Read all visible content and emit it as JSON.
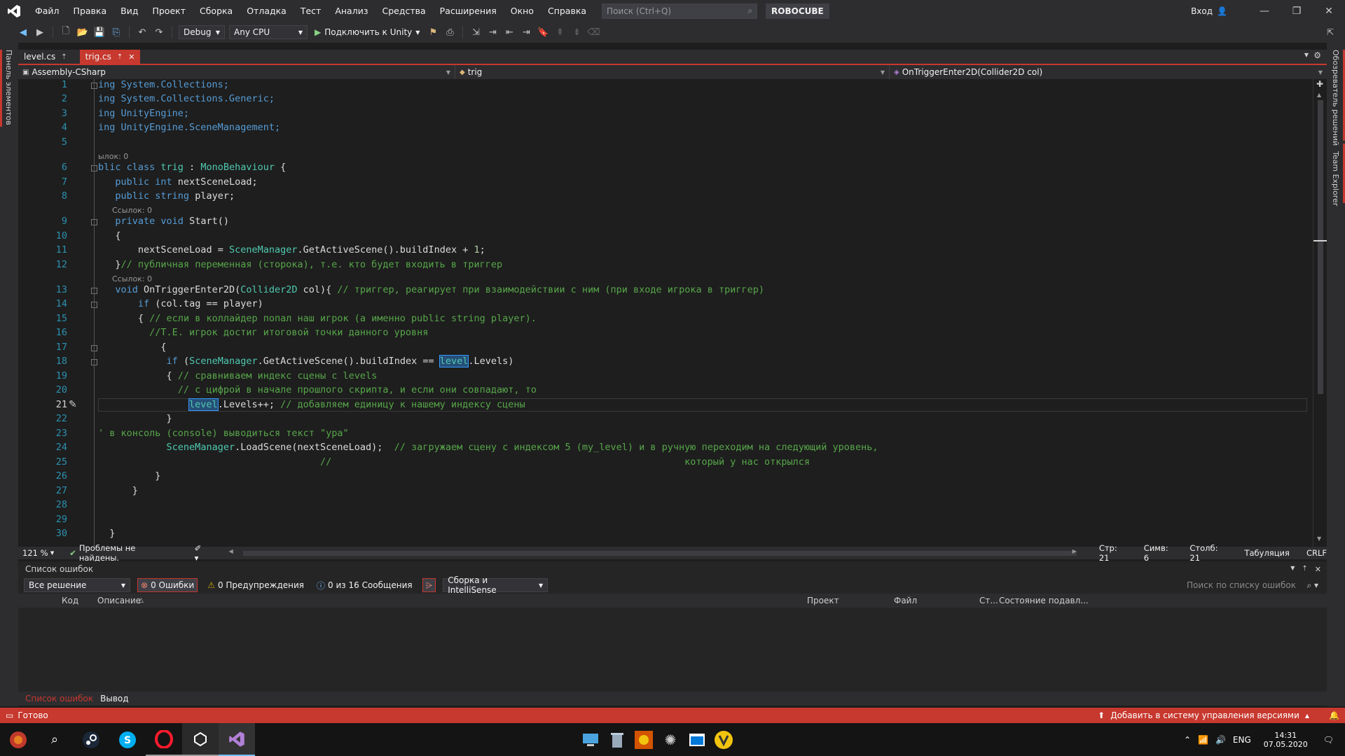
{
  "menubar": {
    "items": [
      "Файл",
      "Правка",
      "Вид",
      "Проект",
      "Сборка",
      "Отладка",
      "Тест",
      "Анализ",
      "Средства",
      "Расширения",
      "Окно",
      "Справка"
    ],
    "search_placeholder": "Поиск (Ctrl+Q)",
    "solution_name": "ROBOCUBE",
    "signin": "Вход"
  },
  "toolbar": {
    "config": "Debug",
    "platform": "Any CPU",
    "attach": "Подключить к Unity"
  },
  "side": {
    "left_tab": "Панель элементов",
    "right_tab_1": "Обозреватель решений",
    "right_tab_2": "Team Explorer"
  },
  "tabs": [
    {
      "name": "level.cs",
      "pin": "⇡"
    },
    {
      "name": "trig.cs",
      "pin": "⇡",
      "close": "✕"
    }
  ],
  "navbar": {
    "project": "Assembly-CSharp",
    "class": "trig",
    "member": "OnTriggerEnter2D(Collider2D col)"
  },
  "editor": {
    "line_numbers": [
      "1",
      "2",
      "3",
      "4",
      "5",
      "6",
      "7",
      "8",
      "9",
      "10",
      "11",
      "12",
      "13",
      "14",
      "15",
      "16",
      "17",
      "18",
      "19",
      "20",
      "21",
      "22",
      "23",
      "24",
      "25",
      "26",
      "27",
      "28",
      "29",
      "30"
    ],
    "codelens_1": "ылок: 0",
    "codelens_2": "Ссылок: 0",
    "codelens_3": "Ссылок: 0",
    "l1": "ing System.Collections;",
    "l2": "ing System.Collections.Generic;",
    "l3": "ing UnityEngine;",
    "l4": "ing UnityEngine.SceneManagement;",
    "l6a": "blic class ",
    "l6b": "trig",
    "l6c": " : ",
    "l6d": "MonoBehaviour",
    "l6e": " {",
    "l7a": "public int",
    "l7b": " nextSceneLoad;",
    "l8a": "public string",
    "l8b": " player;",
    "l9a": "private void",
    "l9b": " Start()",
    "l10": "{",
    "l11a": "nextSceneLoad = ",
    "l11b": "SceneManager",
    "l11c": ".GetActiveScene().buildIndex + ",
    "l11d": "1",
    "l11e": ";",
    "l12a": "}",
    "l12b": "// публичная переменная (сторока), т.е. кто будет входить в триггер",
    "l13a": "void",
    "l13b": " OnTriggerEnter2D(",
    "l13c": "Collider2D",
    "l13d": " col){ ",
    "l13e": "// триггер, реагирует при взаимодействии с ним (при входе игрока в триггер)",
    "l14a": "if",
    "l14b": " (col.tag == player)",
    "l15a": "{ ",
    "l15b": "// если в коллайдер попал наш игрок (а именно public string player).",
    "l16": "//Т.Е. игрок достиг итоговой точки данного уровня",
    "l17": "{",
    "l18a": "if",
    "l18b": " (",
    "l18c": "SceneManager",
    "l18d": ".GetActiveScene().buildIndex == ",
    "l18e": "level",
    "l18f": ".Levels)",
    "l19a": "{ ",
    "l19b": "// сравниваем индекс сцены с levels",
    "l20": "// с цифрой в начале прошлого скрипта, и если они совпадают, то",
    "l21a": "level",
    "l21b": ".Levels++; ",
    "l21c": "// добавляем единицу к нашему индексу сцены",
    "l22": "}",
    "l23": "' в консоль (console) выводиться текст \"ура\"",
    "l24a": "SceneManager",
    "l24b": ".LoadScene(nextSceneLoad);  ",
    "l24c": "// загружаем сцену с индексом 5 (my_level) и в ручную переходим на следующий уровень,",
    "l25a": "//",
    "l25b": "который у нас открылся",
    "l26": "}",
    "l27": "}",
    "l30": "}"
  },
  "editor_status": {
    "zoom": "121 %",
    "issues": "Проблемы не найдены.",
    "line": "Стр: 21",
    "char": "Симв: 6",
    "col": "Столб: 21",
    "tabs": "Табуляция",
    "eol": "CRLF"
  },
  "error_list": {
    "title": "Список ошибок",
    "scope": "Все решение",
    "errors": "0 Ошибки",
    "warnings": "0 Предупреждения",
    "messages": "0 из 16 Сообщения",
    "build_source": "Сборка и IntelliSense",
    "search_placeholder": "Поиск по списку ошибок",
    "columns": {
      "code": "Код",
      "description": "Описание",
      "project": "Проект",
      "file": "Файл",
      "line": "Ст...",
      "suppression": "Состояние подавл..."
    }
  },
  "bottom_tabs": {
    "errors": "Список ошибок",
    "output": "Вывод"
  },
  "statusbar": {
    "ready": "Готово",
    "vcs": "Добавить в систему управления версиями"
  },
  "taskbar": {
    "lang": "ENG",
    "time": "14:31",
    "date": "07.05.2020"
  },
  "colors": {
    "accent_red": "#c7382e",
    "keyword": "#569cd6",
    "type": "#4ec9b0",
    "comment": "#57a64a",
    "line_number": "#2b91af"
  }
}
